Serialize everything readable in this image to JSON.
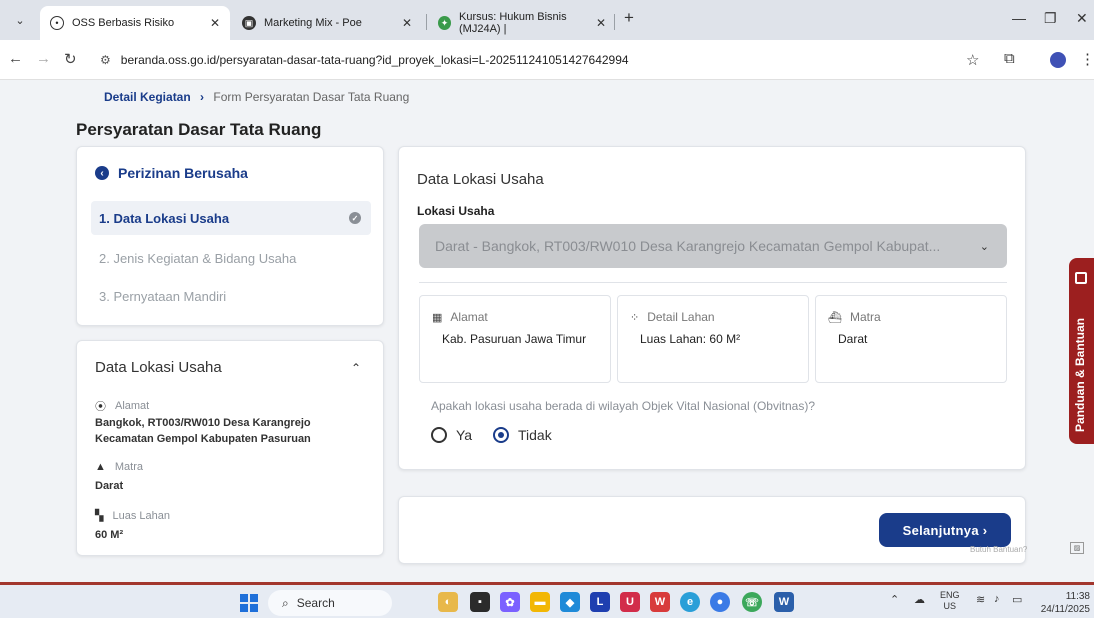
{
  "browser": {
    "tabs": [
      {
        "title": "OSS Berbasis Risiko",
        "active": true
      },
      {
        "title": "Marketing Mix - Poe",
        "active": false
      },
      {
        "title": "Kursus: Hukum Bisnis (MJ24A) |",
        "active": false
      }
    ],
    "url": "beranda.oss.go.id/persyaratan-dasar-tata-ruang?id_proyek_lokasi=L-202511241051427642994"
  },
  "breadcrumb": {
    "parent": "Detail Kegiatan",
    "current": "Form Persyaratan Dasar Tata Ruang"
  },
  "page_title": "Persyaratan Dasar Tata Ruang",
  "steps": {
    "back_label": "Perizinan Berusaha",
    "items": [
      {
        "label": "1. Data Lokasi Usaha",
        "active": true
      },
      {
        "label": "2. Jenis Kegiatan & Bidang Usaha",
        "active": false
      },
      {
        "label": "3. Pernyataan Mandiri",
        "active": false
      }
    ]
  },
  "summary": {
    "title": "Data Lokasi Usaha",
    "alamat_label": "Alamat",
    "alamat_value": "Bangkok, RT003/RW010 Desa Karangrejo Kecamatan Gempol Kabupaten Pasuruan",
    "matra_label": "Matra",
    "matra_value": "Darat",
    "luas_label": "Luas Lahan",
    "luas_value": "60 M²"
  },
  "main": {
    "title": "Data Lokasi Usaha",
    "field_label": "Lokasi Usaha",
    "select_value": "Darat - Bangkok, RT003/RW010 Desa Karangrejo Kecamatan Gempol Kabupat...",
    "info": [
      {
        "label": "Alamat",
        "value": "Kab. Pasuruan Jawa Timur"
      },
      {
        "label": "Detail Lahan",
        "value": "Luas Lahan: 60 M²"
      },
      {
        "label": "Matra",
        "value": "Darat"
      }
    ],
    "question": "Apakah lokasi usaha berada di wilayah Objek Vital Nasional (Obvitnas)?",
    "option_yes": "Ya",
    "option_no": "Tidak",
    "selected": "Tidak"
  },
  "footer": {
    "next_label": "Selanjutnya  ›",
    "help_text": "Butuh Bantuan?"
  },
  "side_tab": "Panduan & Bantuan",
  "taskbar": {
    "search_label": "Search",
    "lang_top": "ENG",
    "lang_bottom": "US",
    "time": "11:38",
    "date": "24/11/2025"
  },
  "colors": {
    "primary": "#1a3c8a",
    "side_tab": "#9c1f1f",
    "select_bg": "#c8cacd"
  }
}
